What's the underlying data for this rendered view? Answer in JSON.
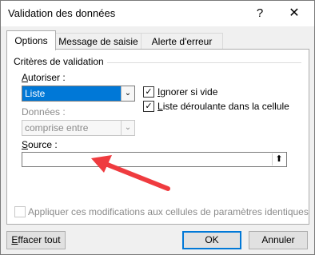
{
  "window": {
    "title": "Validation des données",
    "help_glyph": "?",
    "close_glyph": "✕"
  },
  "tabs": [
    {
      "label": "Options",
      "active": true
    },
    {
      "label": "Message de saisie",
      "active": false
    },
    {
      "label": "Alerte d'erreur",
      "active": false
    }
  ],
  "criteria": {
    "group_label": "Critères de validation",
    "allow_label_prefix": "A",
    "allow_label_rest": "utoriser :",
    "allow_value": "Liste",
    "data_label": "Données :",
    "data_value": "comprise entre",
    "ignore_blank_label_prefix": "I",
    "ignore_blank_label_rest": "gnorer si vide",
    "ignore_blank_checked": true,
    "dropdown_label_prefix": "L",
    "dropdown_label_rest": "iste déroulante dans la cellule",
    "dropdown_checked": true,
    "source_label_prefix": "S",
    "source_label_rest": "ource :",
    "source_value": ""
  },
  "apply_all": {
    "label": "Appliquer ces modifications aux cellules de paramètres identiques",
    "checked": false
  },
  "buttons": {
    "clear_prefix": "E",
    "clear_rest": "ffacer tout",
    "ok": "OK",
    "cancel": "Annuler"
  },
  "colors": {
    "annotation_arrow": "#ef3b3f",
    "accent": "#0078d7"
  }
}
